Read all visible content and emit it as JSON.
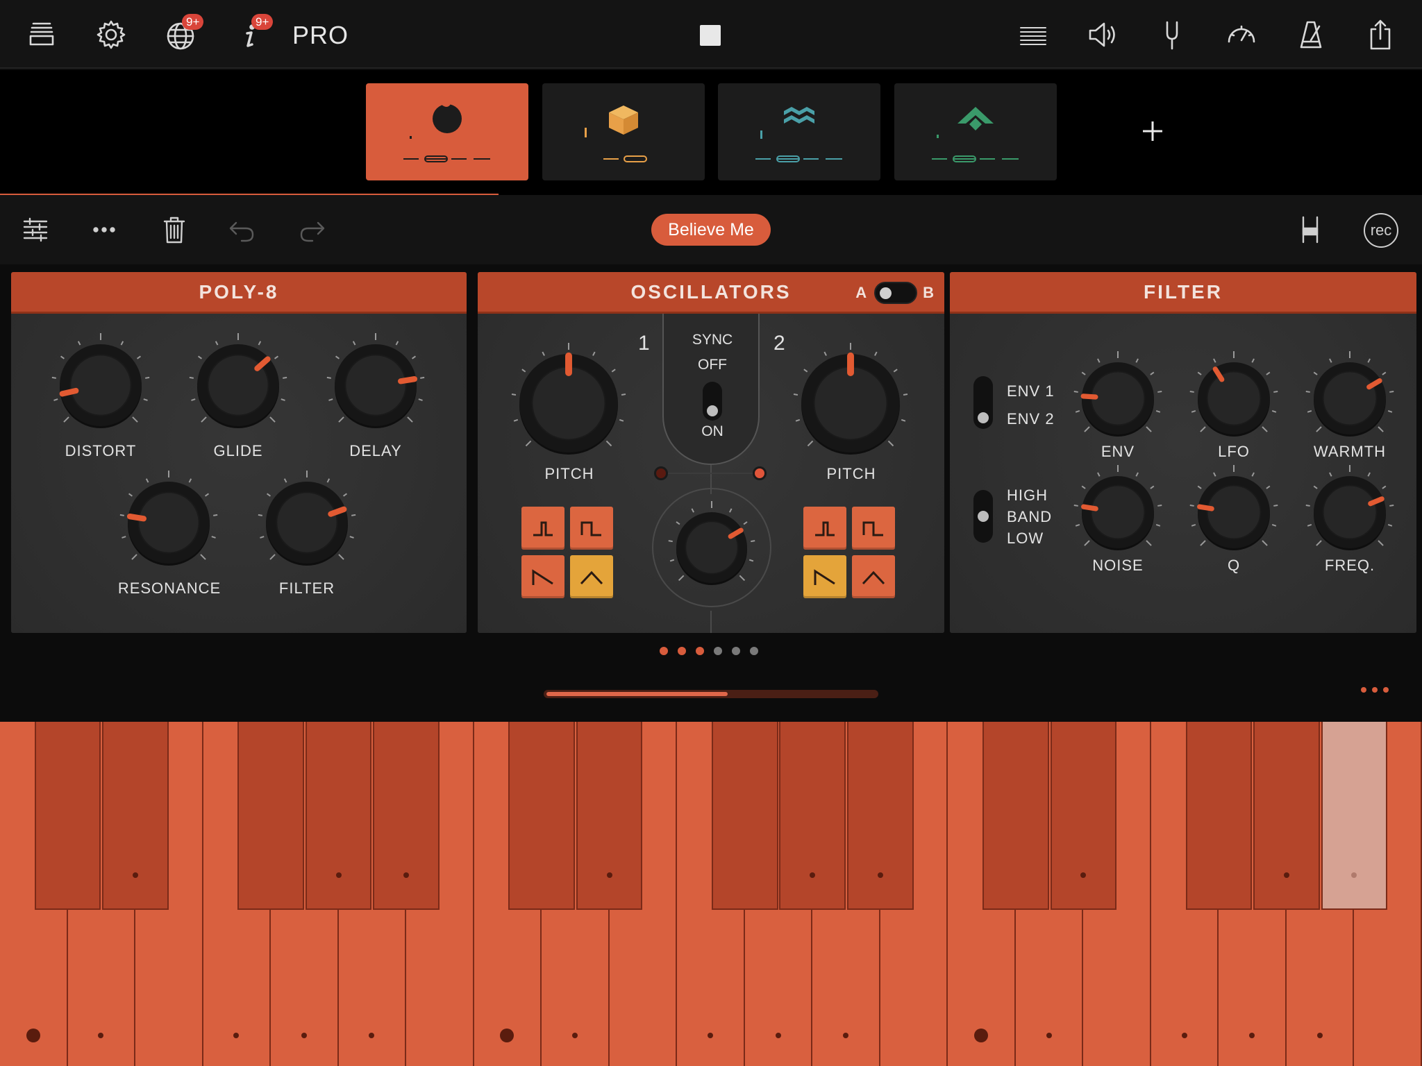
{
  "topbar": {
    "left_icons": [
      {
        "name": "library-icon"
      },
      {
        "name": "settings-gear-icon"
      },
      {
        "name": "globe-icon",
        "badge": "9+"
      },
      {
        "name": "info-icon",
        "badge": "9+"
      }
    ],
    "pro_label": "PRO",
    "stop_button": "stop-icon",
    "right_icons": [
      "mixer-lines-icon",
      "speaker-icon",
      "tuning-fork-icon",
      "speedometer-icon",
      "metronome-icon",
      "share-icon"
    ]
  },
  "tracks": [
    {
      "name": "bass-track",
      "color": "#1c1c1c",
      "active": true
    },
    {
      "name": "box-track",
      "color": "#e8a048"
    },
    {
      "name": "wave-track",
      "color": "#4aa0a8"
    },
    {
      "name": "diamond-track",
      "color": "#3a9a6a"
    }
  ],
  "toolbar": {
    "icons": [
      "sequencer-icon",
      "more-icon",
      "trash-icon",
      "undo-icon",
      "redo-icon"
    ],
    "preset_name": "Believe Me",
    "right_icons": [
      "split-keyboard-icon"
    ],
    "rec_label": "rec"
  },
  "panels": {
    "poly": {
      "title": "POLY-8",
      "knobs": [
        {
          "label": "DISTORT",
          "value": 0.12
        },
        {
          "label": "GLIDE",
          "value": 0.68
        },
        {
          "label": "DELAY",
          "value": 0.8
        },
        {
          "label": "RESONANCE",
          "value": 0.2
        },
        {
          "label": "FILTER",
          "value": 0.76
        }
      ]
    },
    "osc": {
      "title": "OSCILLATORS",
      "toggle_a": "A",
      "toggle_b": "B",
      "osc1_number": "1",
      "osc2_number": "2",
      "sync_label": "SYNC",
      "sync_off": "OFF",
      "sync_on": "ON",
      "pitch1": {
        "label": "PITCH",
        "value": 0.5
      },
      "pitch2": {
        "label": "PITCH",
        "value": 0.5
      },
      "mix_value": 0.72,
      "osc1_waves": [
        {
          "name": "pulse-narrow",
          "on": false
        },
        {
          "name": "square",
          "on": false
        },
        {
          "name": "saw",
          "on": false
        },
        {
          "name": "triangle",
          "on": true
        }
      ],
      "osc2_waves": [
        {
          "name": "pulse-narrow",
          "on": false
        },
        {
          "name": "square",
          "on": false
        },
        {
          "name": "saw",
          "on": true
        },
        {
          "name": "triangle",
          "on": false
        }
      ],
      "led1_color": "#5a1a10",
      "led2_color": "#e0553a"
    },
    "filter": {
      "title": "FILTER",
      "env_options": [
        "ENV 1",
        "ENV 2"
      ],
      "band_options": [
        "HIGH",
        "BAND",
        "LOW"
      ],
      "knobs": [
        {
          "label": "ENV",
          "value": 0.18
        },
        {
          "label": "LFO",
          "value": 0.38
        },
        {
          "label": "WARMTH",
          "value": 0.72
        },
        {
          "label": "NOISE",
          "value": 0.2
        },
        {
          "label": "Q",
          "value": 0.2
        },
        {
          "label": "FREQ.",
          "value": 0.75
        }
      ]
    }
  },
  "pager": {
    "count": 6,
    "active": [
      0,
      1,
      2
    ]
  },
  "scroll": {
    "fraction": 0.55
  },
  "keyboard": {
    "white_key_count": 21,
    "lit_black_key_index": 14
  }
}
